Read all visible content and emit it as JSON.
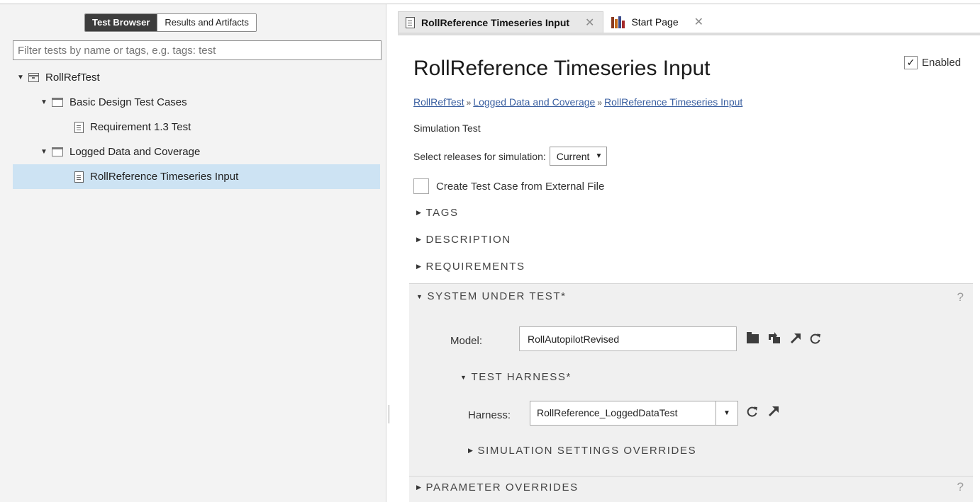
{
  "left_panel": {
    "tabs": {
      "test_browser": "Test Browser",
      "results": "Results and Artifacts"
    },
    "filter_placeholder": "Filter tests by name or tags, e.g. tags: test",
    "tree": {
      "root": "RollRefTest",
      "suite1": "Basic Design Test Cases",
      "case1": "Requirement 1.3 Test",
      "suite2": "Logged Data and Coverage",
      "case2": "RollReference Timeseries Input"
    }
  },
  "tabs": {
    "active": "RollReference Timeseries Input",
    "start": "Start Page",
    "close_glyph": "✕"
  },
  "editor": {
    "title": "RollReference Timeseries Input",
    "enabled_label": "Enabled",
    "enabled_check": "✓",
    "breadcrumb": {
      "item1": "RollRefTest",
      "item2": "Logged Data and Coverage",
      "item3": "RollReference Timeseries Input",
      "sep": "»"
    },
    "test_type": "Simulation Test",
    "releases_label": "Select releases for simulation:",
    "releases_value": "Current",
    "external_file_label": "Create Test Case from External File",
    "sections": {
      "tags": "TAGS",
      "description": "DESCRIPTION",
      "requirements": "REQUIREMENTS",
      "sut": "SYSTEM UNDER TEST*",
      "test_harness": "TEST HARNESS*",
      "sim_overrides": "SIMULATION SETTINGS OVERRIDES",
      "param_overrides": "PARAMETER OVERRIDES"
    },
    "help_glyph": "?",
    "model_label": "Model:",
    "model_value": "RollAutopilotRevised",
    "harness_label": "Harness:",
    "harness_value": "RollReference_LoggedDataTest"
  },
  "glyphs": {
    "expanded": "▼",
    "collapsed": "▶",
    "caret": "▼"
  },
  "icons": {
    "tree_root": "test-file-icon",
    "tree_suite": "folder-icon",
    "tree_case": "document-icon",
    "model_actions": [
      "folder-icon",
      "open-harness-icon",
      "open-model-icon",
      "refresh-icon"
    ],
    "harness_actions": [
      "refresh-icon",
      "open-model-icon"
    ]
  },
  "colors": {
    "selection": "#cde3f3",
    "link": "#3a5fa0",
    "active_segment": "#3d3d3d"
  }
}
